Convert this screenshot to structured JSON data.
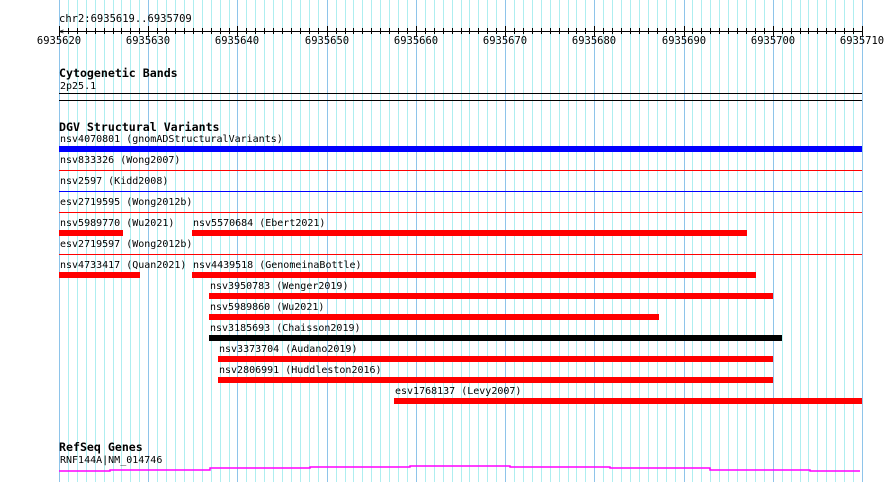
{
  "ruler": {
    "location": "chr2:6935619..6935709",
    "start": 6935620,
    "end": 6935710,
    "major_labels": [
      "6935620",
      "6935630",
      "6935640",
      "6935650",
      "6935660",
      "6935670",
      "6935680",
      "6935690",
      "6935700",
      "6935710"
    ]
  },
  "cyto": {
    "title": "Cytogenetic Bands",
    "band": "2p25.1"
  },
  "dgv": {
    "title": "DGV Structural Variants",
    "features": [
      {
        "label": "nsv4070801 (gnomADStructuralVariants)",
        "start": 6935620,
        "end": 6935710,
        "color": "#0000ff",
        "style": "bar",
        "row": 0
      },
      {
        "label": "nsv833326 (Wong2007)",
        "start": 6935620,
        "end": 6935710,
        "color": "#ff0000",
        "style": "line",
        "row": 1
      },
      {
        "label": "nsv2597 (Kidd2008)",
        "start": 6935620,
        "end": 6935710,
        "color": "#0000ff",
        "style": "line",
        "row": 2
      },
      {
        "label": "esv2719595 (Wong2012b)",
        "start": 6935620,
        "end": 6935710,
        "color": "#ff0000",
        "style": "line",
        "row": 3
      },
      {
        "label": "nsv5989770 (Wu2021)",
        "start": 6935620,
        "end": 6935627.2,
        "color": "#ff0000",
        "style": "bar",
        "row": 4
      },
      {
        "label": "nsv5570684 (Ebert2021)",
        "start": 6935634.9,
        "end": 6935697.1,
        "color": "#ff0000",
        "style": "bar",
        "row": 4
      },
      {
        "label": "esv2719597 (Wong2012b)",
        "start": 6935620,
        "end": 6935710,
        "color": "#ff0000",
        "style": "line",
        "row": 5
      },
      {
        "label": "nsv4733417 (Quan2021)",
        "start": 6935620,
        "end": 6935629.1,
        "color": "#ff0000",
        "style": "bar",
        "row": 6
      },
      {
        "label": "nsv4439518 (GenomeinaBottle)",
        "start": 6935634.9,
        "end": 6935698.1,
        "color": "#ff0000",
        "style": "bar",
        "row": 6
      },
      {
        "label": "nsv3950783 (Wenger2019)",
        "start": 6935636.8,
        "end": 6935700.0,
        "color": "#ff0000",
        "style": "bar",
        "row": 7
      },
      {
        "label": "nsv5989860 (Wu2021)",
        "start": 6935636.8,
        "end": 6935687.2,
        "color": "#ff0000",
        "style": "bar",
        "row": 8
      },
      {
        "label": "nsv3185693 (Chaisson2019)",
        "start": 6935636.8,
        "end": 6935701.0,
        "color": "#000000",
        "style": "bar",
        "row": 9
      },
      {
        "label": "nsv3373704 (Audano2019)",
        "start": 6935637.8,
        "end": 6935700.0,
        "color": "#ff0000",
        "style": "bar",
        "row": 10
      },
      {
        "label": "nsv2806991 (Huddleston2016)",
        "start": 6935637.8,
        "end": 6935700.0,
        "color": "#ff0000",
        "style": "bar",
        "row": 11
      },
      {
        "label": "esv1768137 (Levy2007)",
        "start": 6935657.5,
        "end": 6935710,
        "color": "#ff0000",
        "style": "bar",
        "row": 12
      }
    ]
  },
  "refseq": {
    "title": "RefSeq Genes",
    "gene": "RNF144A|NM_014746",
    "color": "#ff00ff"
  }
}
